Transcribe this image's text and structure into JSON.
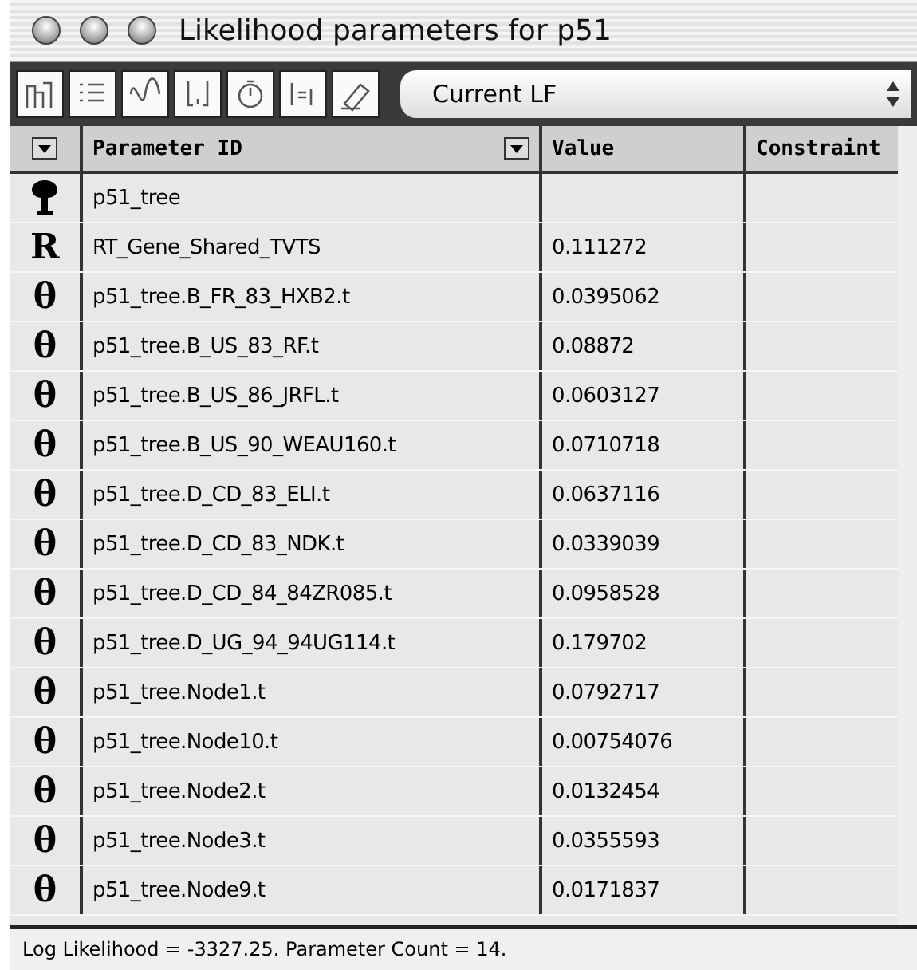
{
  "window": {
    "title": "Likelihood parameters for p51"
  },
  "toolbar": {
    "popup": {
      "value": "Current LF"
    }
  },
  "table": {
    "columns": [
      "Parameter ID",
      "Value",
      "Constraint"
    ],
    "rows": [
      {
        "kind": "tree",
        "id": "p51_tree",
        "value": ""
      },
      {
        "kind": "symbol",
        "symbol": "R",
        "id": "RT_Gene_Shared_TVTS",
        "value": "0.111272"
      },
      {
        "kind": "symbol",
        "symbol": "θ",
        "id": "p51_tree.B_FR_83_HXB2.t",
        "value": "0.0395062"
      },
      {
        "kind": "symbol",
        "symbol": "θ",
        "id": "p51_tree.B_US_83_RF.t",
        "value": "0.08872"
      },
      {
        "kind": "symbol",
        "symbol": "θ",
        "id": "p51_tree.B_US_86_JRFL.t",
        "value": "0.0603127"
      },
      {
        "kind": "symbol",
        "symbol": "θ",
        "id": "p51_tree.B_US_90_WEAU160.t",
        "value": "0.0710718"
      },
      {
        "kind": "symbol",
        "symbol": "θ",
        "id": "p51_tree.D_CD_83_ELI.t",
        "value": "0.0637116"
      },
      {
        "kind": "symbol",
        "symbol": "θ",
        "id": "p51_tree.D_CD_83_NDK.t",
        "value": "0.0339039"
      },
      {
        "kind": "symbol",
        "symbol": "θ",
        "id": "p51_tree.D_CD_84_84ZR085.t",
        "value": "0.0958528"
      },
      {
        "kind": "symbol",
        "symbol": "θ",
        "id": "p51_tree.D_UG_94_94UG114.t",
        "value": "0.179702"
      },
      {
        "kind": "symbol",
        "symbol": "θ",
        "id": "p51_tree.Node1.t",
        "value": "0.0792717"
      },
      {
        "kind": "symbol",
        "symbol": "θ",
        "id": "p51_tree.Node10.t",
        "value": "0.00754076"
      },
      {
        "kind": "symbol",
        "symbol": "θ",
        "id": "p51_tree.Node2.t",
        "value": "0.0132454"
      },
      {
        "kind": "symbol",
        "symbol": "θ",
        "id": "p51_tree.Node3.t",
        "value": "0.0355593"
      },
      {
        "kind": "symbol",
        "symbol": "θ",
        "id": "p51_tree.Node9.t",
        "value": "0.0171837"
      }
    ]
  },
  "status_bar": "Log Likelihood = -3327.25. Parameter Count = 14."
}
